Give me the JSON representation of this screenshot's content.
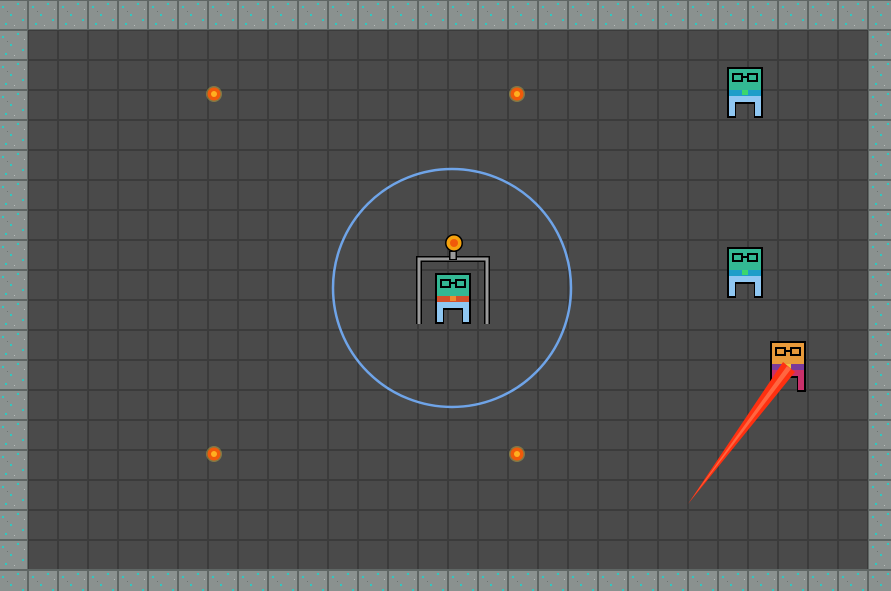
{
  "game": {
    "colors": {
      "floor": "#4a4a4a",
      "grid_line": "#3b3b3b",
      "wall": "#8a918f",
      "wall_speck": "#2fc9c0",
      "range_ring": "#6fa4e8",
      "fire": "#f05a0a",
      "laser": "#ff3010",
      "turret_frame": "#9a9a9a",
      "cannon": "#f5a20e"
    },
    "icons": {
      "player": "robot-player-icon",
      "enemy_teal": "robot-enemy-teal-icon",
      "enemy_orange": "robot-enemy-orange-icon",
      "turret": "turret-cage-icon",
      "torch": "floor-torch-icon",
      "laser": "laser-beam-icon"
    },
    "state": {
      "player_in_turret": true,
      "range_ring_visible": true,
      "laser_active": true
    }
  }
}
